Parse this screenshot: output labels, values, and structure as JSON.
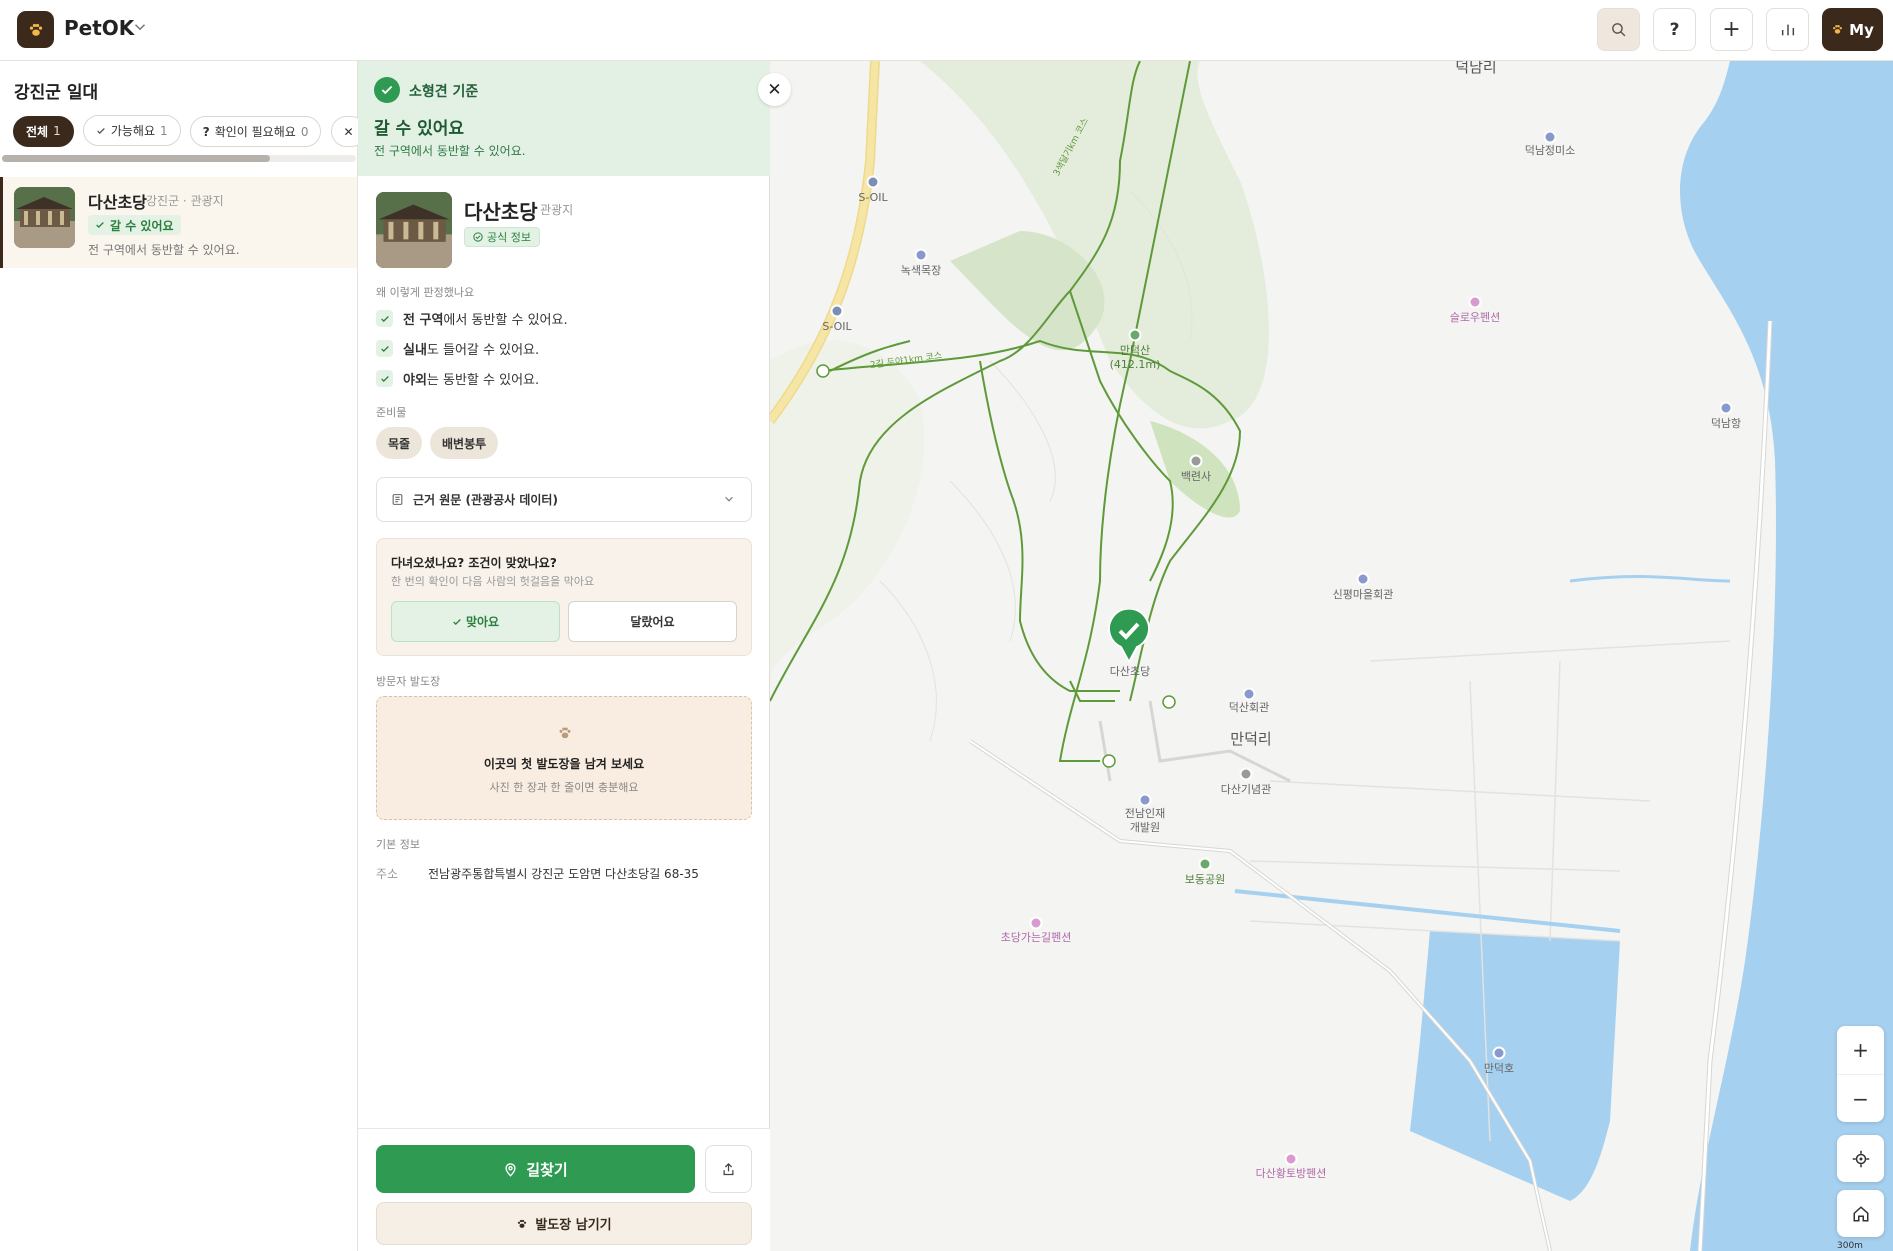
{
  "header": {
    "app_name": "PetOK",
    "search_icon": "search-icon",
    "help_label": "?",
    "add_label": "+",
    "stats_icon": "bar-chart-icon",
    "my_label": "My"
  },
  "sidebar": {
    "region_title": "강진군 일대",
    "filters": [
      {
        "label": "전체",
        "count": "1",
        "active": true
      },
      {
        "label": "가능해요",
        "count": "1"
      },
      {
        "label": "확인이 필요해요",
        "count": "0"
      }
    ],
    "items": [
      {
        "title": "다산초당",
        "meta": "강진군 · 관광지",
        "badge": "갈 수 있어요",
        "desc": "전 구역에서 동반할 수 있어요."
      }
    ]
  },
  "detail": {
    "criterion": "소형견 기준",
    "verdict_title": "갈 수 있어요",
    "verdict_sub": "전 구역에서 동반할 수 있어요.",
    "place_title": "다산초당",
    "place_type": "관광지",
    "official_badge": "공식 정보",
    "reasons_label": "왜 이렇게 판정했나요",
    "reasons": [
      {
        "bold": "전 구역",
        "rest": "에서 동반할 수 있어요."
      },
      {
        "bold": "실내",
        "rest": "도 들어갈 수 있어요."
      },
      {
        "bold": "야외",
        "rest": "는 동반할 수 있어요."
      }
    ],
    "prep_label": "준비물",
    "prep_items": [
      "목줄",
      "배변봉투"
    ],
    "source_label": "근거 원문 (관광공사 데이터)",
    "confirm_title": "다녀오셨나요? 조건이 맞았나요?",
    "confirm_sub": "한 번의 확인이 다음 사람의 헛걸음을 막아요",
    "confirm_yes": "맞아요",
    "confirm_no": "달랐어요",
    "footprint_label": "방문자 발도장",
    "footprint_title": "이곳의 첫 발도장을 남겨 보세요",
    "footprint_sub": "사진 한 장과 한 줄이면 충분해요",
    "basic_info_label": "기본 정보",
    "address_key": "주소",
    "address_value": "전남광주통합특별시 강진군 도암면 다산초당길 68-35",
    "nav_button": "길찾기",
    "footprint_button": "발도장 남기기"
  },
  "map": {
    "labels": {
      "deoknamri": "덕남리",
      "deoknam_museum": "덕남정미소",
      "soil_1": "S-OIL",
      "soil_2": "S-OIL",
      "nokse": "녹색목장",
      "mandeoksan_1": "만덕산",
      "mandeoksan_2": "(412.1m)",
      "slowpension": "슬로우펜션",
      "deoknam_port": "덕남항",
      "baekryeonsa": "백련사",
      "sinpyeong": "신평마을회관",
      "dasancho": "다산초당",
      "deoksan": "덕산회관",
      "mandeokri": "만덕리",
      "dasan_memorial": "다산기념관",
      "jeonnam_1": "전남인재",
      "jeonnam_2": "개발원",
      "bodong": "보동공원",
      "chodang_pension": "초당가는길펜션",
      "mandeokho": "만덕호",
      "dasan_hwangto": "다산황토방펜션",
      "trail_1": "3색달기km 코스",
      "trail_2": "2길 두야1km 코스"
    },
    "scale": "300m",
    "colors": {
      "sea": "#a6d0ef",
      "trail": "#5e9a3a",
      "road": "#f6e6a6",
      "marker": "#2e9a52"
    }
  }
}
